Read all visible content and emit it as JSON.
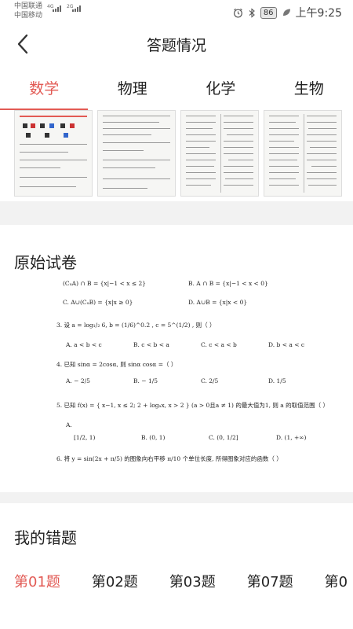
{
  "status_bar": {
    "carrier_1": "中国联通",
    "carrier_2": "中国移动",
    "net_1": "4G",
    "net_2": "2G",
    "battery": "86",
    "time": "上午9:25",
    "icons": [
      "alarm-icon",
      "bluetooth-icon",
      "battery-icon",
      "leaf-icon"
    ]
  },
  "header": {
    "back_icon": "chevron-left-icon",
    "title": "答题情况"
  },
  "tabs": [
    {
      "label": "数学",
      "active": true
    },
    {
      "label": "物理",
      "active": false
    },
    {
      "label": "化学",
      "active": false
    },
    {
      "label": "生物",
      "active": false
    }
  ],
  "sections": {
    "original_paper": "原始试卷",
    "wrong_questions": "我的错题"
  },
  "paper": {
    "lines": [
      {
        "a": "(CᵤA) ∩ B = {x|−1 < x ≤ 2}",
        "b": "B.  A ∩ B = {x|−1 < x < 0}"
      },
      {
        "a": "C.   A∪(CᵤB) = {x|x ≥ 0}",
        "b": "D.   A∪B = {x|x < 0}"
      },
      {
        "text": "3. 设 a = log₁/₂ 6,   b = (1/6)^0.2 ,   c = 5^(1/2) ,  则（      ）"
      },
      {
        "opts": [
          "A.   a < b < c",
          "B.   c < b < a",
          "C.   c < a < b",
          "D.   b < a < c"
        ]
      },
      {
        "text": "4. 已知 sinα = 2cosα, 则 sinα cosα =（      ）"
      },
      {
        "opts": [
          "A.   − 2/5",
          "B.   − 1/5",
          "C.   2/5",
          "D.   1/5"
        ]
      },
      {
        "text": "5. 已知 f(x) = { x−1, x ≤ 2;  2 + logₐx, x > 2 }  (a > 0且a ≠ 1) 的最大值为1, 则 a 的取值范围（      ）"
      },
      {
        "text": "A."
      },
      {
        "opts": [
          "[1/2, 1)",
          "B.   (0, 1)",
          "C.   (0, 1/2]",
          "D.   (1, +∞)"
        ]
      },
      {
        "text": "6. 将 y = sin(2x + π/5) 的图象向右平移 π/10 个单位长度, 所得图象对应的函数（      ）"
      }
    ]
  },
  "questions": [
    {
      "label": "第01题",
      "active": true
    },
    {
      "label": "第02题",
      "active": false
    },
    {
      "label": "第03题",
      "active": false
    },
    {
      "label": "第07题",
      "active": false
    },
    {
      "label": "第0",
      "active": false
    }
  ],
  "colors": {
    "accent": "#e25a54",
    "band": "#f2f2f2"
  }
}
